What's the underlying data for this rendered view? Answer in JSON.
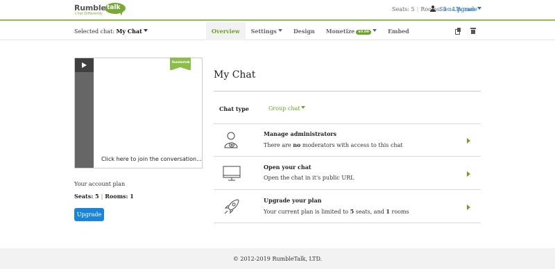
{
  "header": {
    "logo_word": "Rumble",
    "logo_bubble": "talk",
    "logo_tagline": "Chat Differently",
    "seats_label": "Seats: 5",
    "rooms_label": "Rooms: 1",
    "upgrade_link": "Upgrade",
    "user_name": "Siena Romes"
  },
  "subnav": {
    "selected_prefix": "Selected chat:",
    "selected_value": "My Chat",
    "tabs": [
      {
        "label": "Overview",
        "active": true
      },
      {
        "label": "Settings"
      },
      {
        "label": "Design"
      },
      {
        "label": "Monetize",
        "badge": "$0.00"
      },
      {
        "label": "Embed"
      }
    ],
    "icons": [
      "copy-icon",
      "trash-icon"
    ]
  },
  "preview": {
    "ribbon_text": "Rumbletalk",
    "join_text": "Click here to join the conversation..."
  },
  "plan": {
    "label": "Your account plan",
    "seats": "Seats: 5",
    "rooms": "Rooms: 1",
    "button": "Upgrade"
  },
  "main": {
    "title": "My Chat",
    "chat_type_label": "Chat type",
    "chat_type_value": "Group chat",
    "options": [
      {
        "title": "Manage administrators",
        "desc_before": "There are",
        "desc_bold": "no",
        "desc_after": "moderators with access to this chat",
        "icon": "admin-user-icon"
      },
      {
        "title": "Open your chat",
        "desc": "Open the chat in it's public URL",
        "icon": "monitor-icon"
      },
      {
        "title": "Upgrade your plan",
        "desc_before": "Your current plan is limited to",
        "seats_bold": "5",
        "desc_mid": "seats, and",
        "rooms_bold": "1",
        "desc_after": "rooms",
        "icon": "rocket-icon"
      }
    ]
  },
  "footer": {
    "copyright": "© 2012-2019 RumbleTalk, LTD."
  },
  "colors": {
    "accent_green": "#6aa326",
    "link_blue": "#1f6fb6",
    "button_blue": "#1a85d8"
  }
}
